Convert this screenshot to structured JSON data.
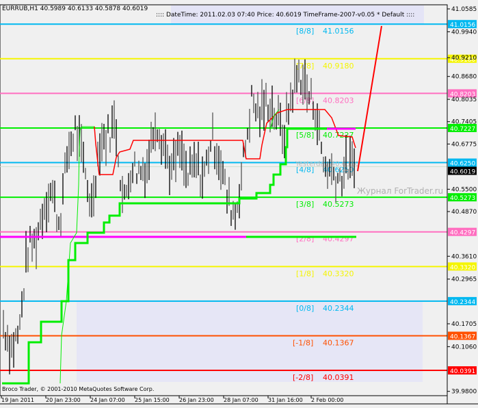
{
  "header": {
    "symbol_info": "EURRUB,H1  40.5989 40.6133 40.5878 40.6019",
    "info_bar": ":::: DateTime: 2011.02.03 07:40   Price: 40.6019   TimeFrame-2007-v0.05    *  Default  ::::"
  },
  "footer": {
    "copyright": "Broco Trader, © 2001-2010 MetaQuotes Software Corp."
  },
  "watermark": "Журнал ForTrader.ru",
  "colors": {
    "background": "#f0f0f0",
    "bars": "#000000",
    "red_line": "#ff0000",
    "green": "#00ee00",
    "magenta": "#ff00ff"
  },
  "chart_data": {
    "type": "bar",
    "symbol": "EURRUB",
    "timeframe": "H1",
    "ylim": [
      39.98,
      41.0585
    ],
    "y_ticks": [
      "41.0585",
      "40.9940",
      "40.9210",
      "40.8680",
      "40.8035",
      "40.7405",
      "40.6775",
      "40.5500",
      "40.4870",
      "40.3610",
      "40.2965",
      "40.1705",
      "40.1060",
      "39.9800"
    ],
    "x_ticks": [
      "19 Jan 2011",
      "20 Jan 23:00",
      "24 Jan 07:00",
      "25 Jan 15:00",
      "26 Jan 23:00",
      "28 Jan 07:00",
      "31 Jan 16:00",
      "2 Feb 00:00"
    ],
    "current_price": "40.6019",
    "murrey_levels": [
      {
        "tag": "[8/8]",
        "value": "41.0156",
        "color": "#00b8f0"
      },
      {
        "tag": "[7/8]",
        "value": "40.9180",
        "color": "#f5f500"
      },
      {
        "tag": "[6/8]",
        "value": "40.8203",
        "color": "#ff6ec0"
      },
      {
        "tag": "[5/8]",
        "value": "40.7227",
        "color": "#00ee00"
      },
      {
        "tag": "[4/8]",
        "value": "40.6250",
        "color": "#00b8f0"
      },
      {
        "tag": "[3/8]",
        "value": "40.5273",
        "color": "#00ee00"
      },
      {
        "tag": "[2/8]",
        "value": "40.4297",
        "color": "#ff6ec0"
      },
      {
        "tag": "[1/8]",
        "value": "40.3320",
        "color": "#f5f500"
      },
      {
        "tag": "[0/8]",
        "value": "40.2344",
        "color": "#00b8f0"
      },
      {
        "tag": "[-1/8]",
        "value": "40.1367",
        "color": "#ff5000"
      },
      {
        "tag": "[-2/8]",
        "value": "40.0391",
        "color": "#ff0000"
      }
    ],
    "yesterday_label": "Yesterday 40.6310",
    "yesterday_value": 40.631,
    "price_path": [
      40.17,
      40.1,
      40.15,
      40.38,
      40.4,
      40.5,
      40.55,
      40.45,
      40.65,
      40.72,
      40.62,
      40.5,
      40.68,
      40.7,
      40.74,
      40.5,
      40.62,
      40.6,
      40.62,
      40.75,
      40.68,
      40.6,
      40.66,
      40.58,
      40.62,
      40.58,
      40.7,
      40.64,
      40.52,
      40.48,
      40.63,
      40.8,
      40.76,
      40.8,
      40.76,
      40.7,
      40.82,
      40.88,
      40.82,
      40.78,
      40.62,
      40.6,
      40.58,
      40.62,
      40.6
    ]
  }
}
